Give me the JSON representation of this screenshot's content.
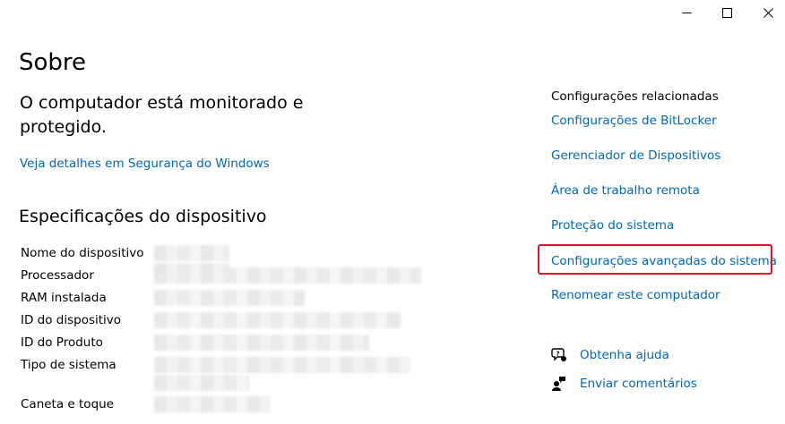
{
  "window": {
    "title": "Sobre"
  },
  "protection": {
    "message": "O computador está monitorado e protegido.",
    "security_link": "Veja detalhes em Segurança do Windows"
  },
  "specs": {
    "title": "Especificações do dispositivo",
    "labels": [
      "Nome do dispositivo",
      "Processador",
      "RAM instalada",
      "ID do dispositivo",
      "ID do Produto",
      "Tipo de sistema",
      "Caneta e toque"
    ]
  },
  "related": {
    "header": "Configurações relacionadas",
    "links": [
      "Configurações de BitLocker",
      "Gerenciador de Dispositivos",
      "Área de trabalho remota",
      "Proteção do sistema",
      "Configurações avançadas do sistema",
      "Renomear este computador"
    ],
    "highlighted_index": 4
  },
  "help": {
    "get_help": "Obtenha ajuda",
    "feedback": "Enviar comentários"
  },
  "colors": {
    "link": "#0067b8",
    "highlight": "#e81123"
  },
  "icons": {
    "minimize": "minimize-icon",
    "maximize": "maximize-icon",
    "close": "close-icon",
    "help": "help-chat-icon",
    "feedback": "feedback-person-icon"
  }
}
